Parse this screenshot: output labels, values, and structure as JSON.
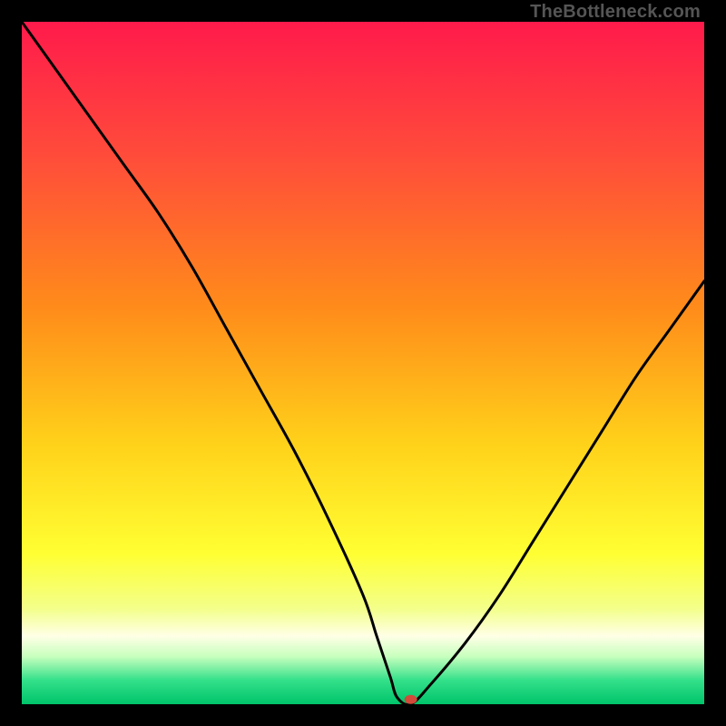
{
  "watermark": "TheBottleneck.com",
  "chart_data": {
    "type": "line",
    "title": "",
    "xlabel": "",
    "ylabel": "",
    "xlim": [
      0,
      100
    ],
    "ylim": [
      0,
      100
    ],
    "series": [
      {
        "name": "bottleneck-curve",
        "x": [
          0,
          5,
          10,
          15,
          20,
          25,
          30,
          35,
          40,
          45,
          50,
          52,
          54,
          55,
          57,
          60,
          65,
          70,
          75,
          80,
          85,
          90,
          95,
          100
        ],
        "y": [
          100,
          93,
          86,
          79,
          72,
          64,
          55,
          46,
          37,
          27,
          16,
          10,
          4,
          1,
          0,
          3,
          9,
          16,
          24,
          32,
          40,
          48,
          55,
          62
        ]
      }
    ],
    "marker": {
      "x": 57,
      "y": 0.7,
      "color": "#d24a3a"
    },
    "gradient_stops": [
      {
        "offset": 0.0,
        "color": "#ff1a4b"
      },
      {
        "offset": 0.2,
        "color": "#ff4d3a"
      },
      {
        "offset": 0.42,
        "color": "#ff8c1a"
      },
      {
        "offset": 0.62,
        "color": "#ffd21a"
      },
      {
        "offset": 0.78,
        "color": "#ffff33"
      },
      {
        "offset": 0.86,
        "color": "#f3ff8a"
      },
      {
        "offset": 0.9,
        "color": "#ffffe6"
      },
      {
        "offset": 0.93,
        "color": "#c8ffbe"
      },
      {
        "offset": 0.965,
        "color": "#33e08a"
      },
      {
        "offset": 1.0,
        "color": "#00c46a"
      }
    ]
  }
}
